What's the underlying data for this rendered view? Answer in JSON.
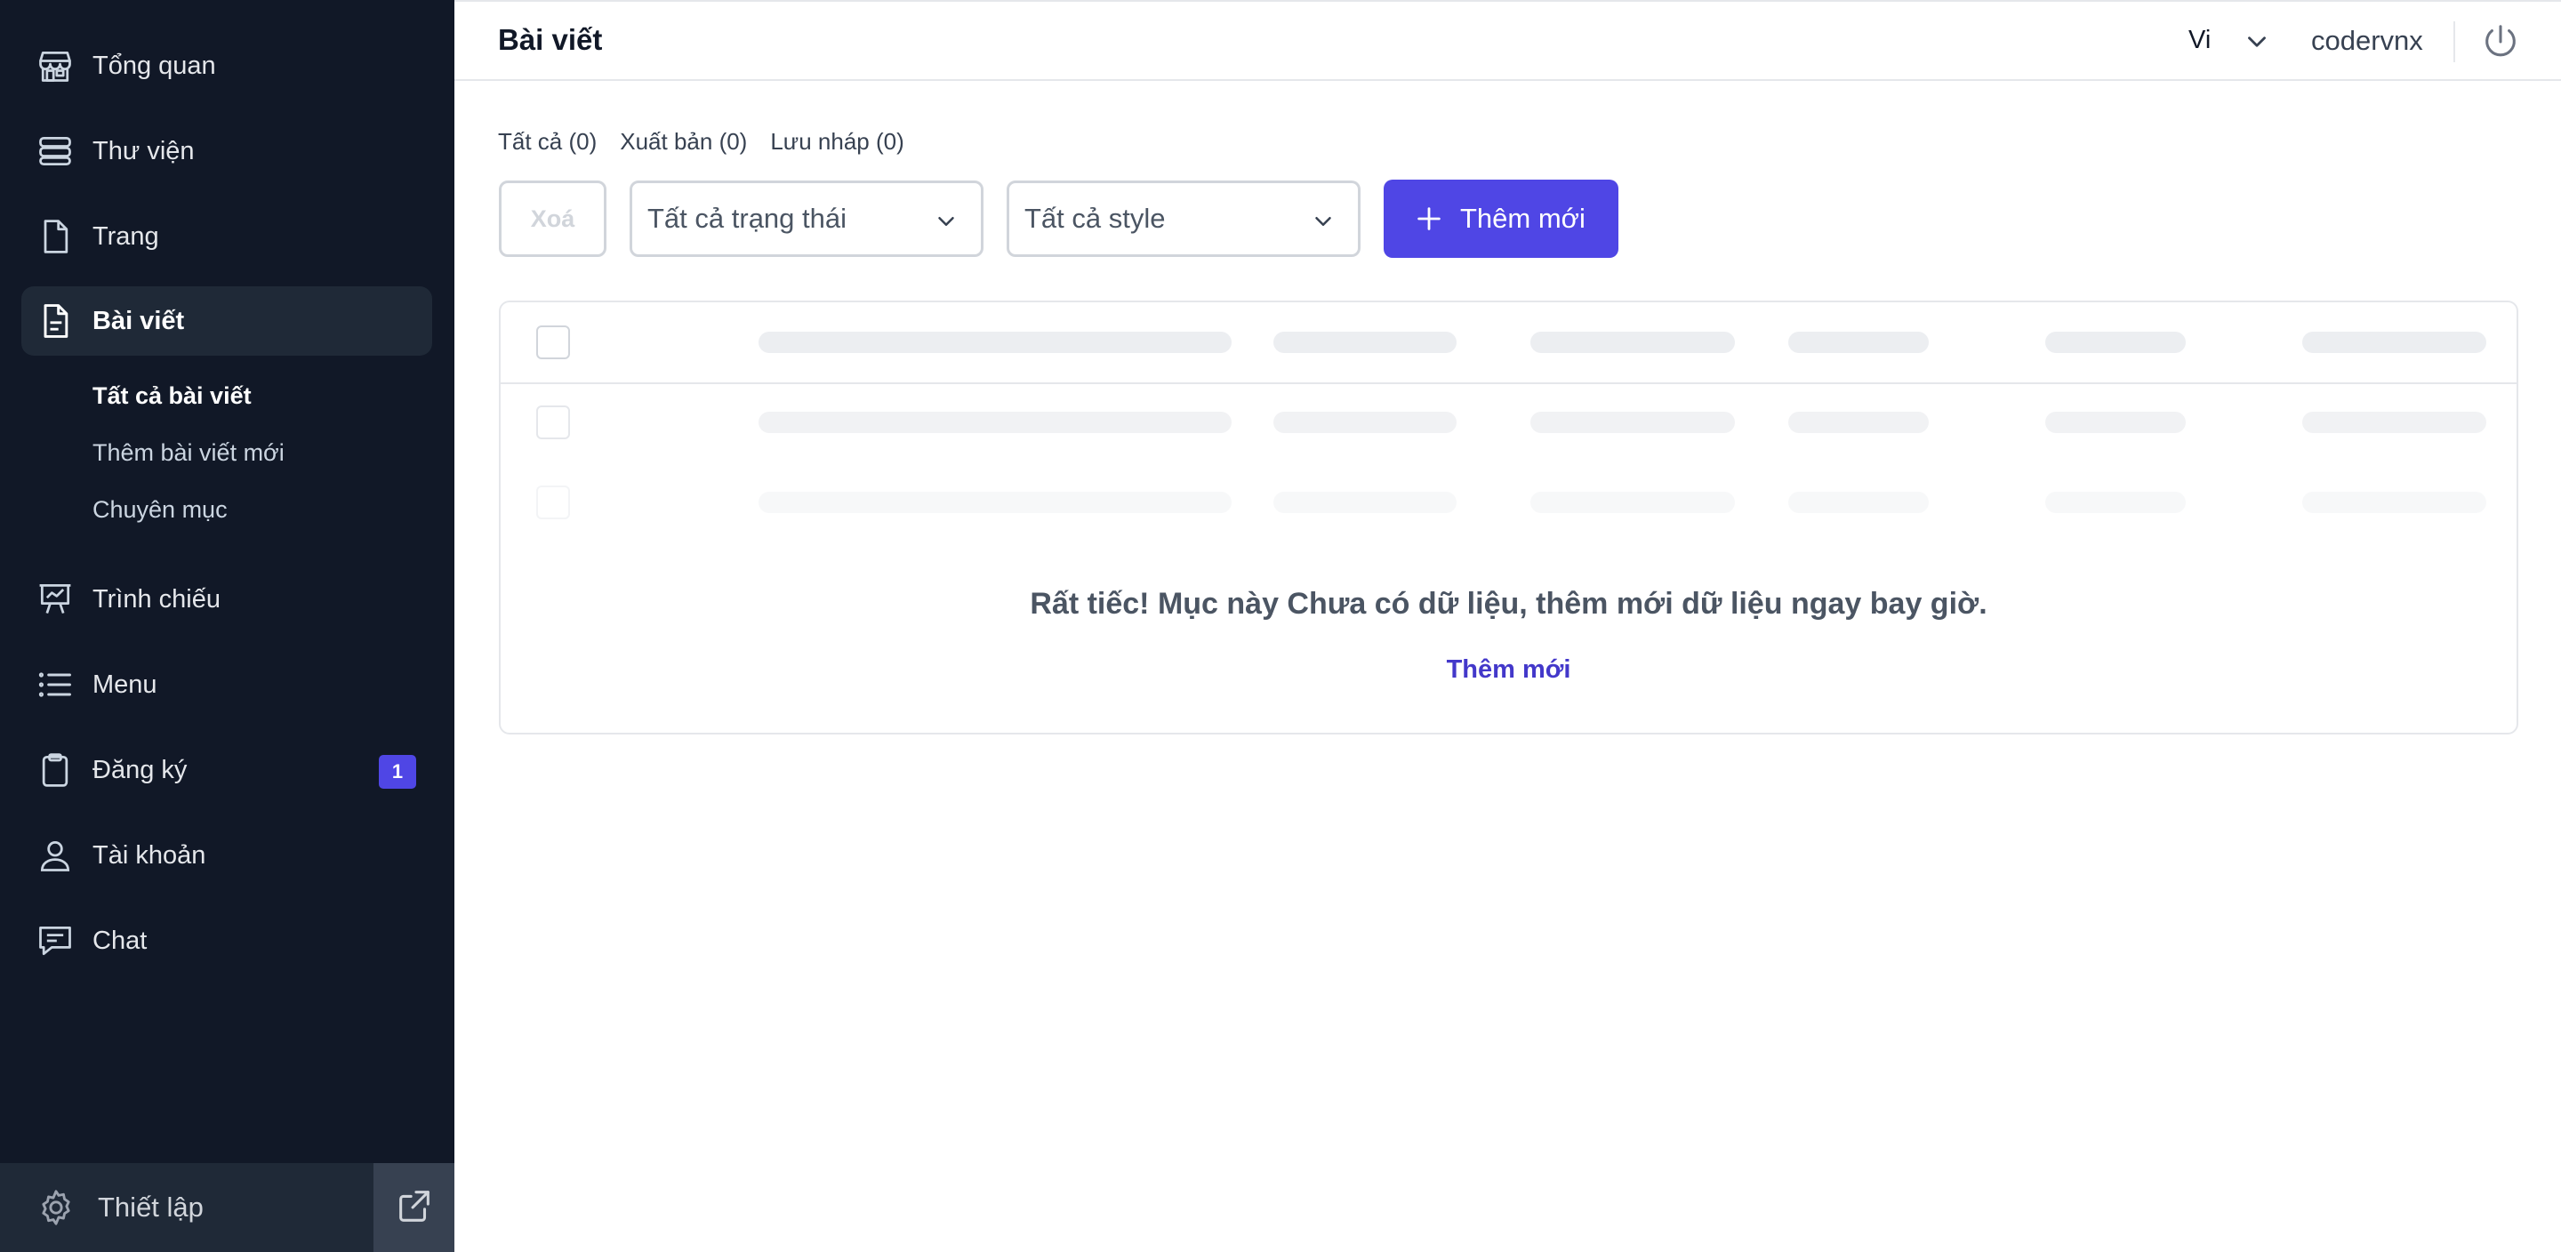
{
  "sidebar": {
    "items": [
      {
        "label": "Tổng quan",
        "icon": "store-icon"
      },
      {
        "label": "Thư viện",
        "icon": "database-icon"
      },
      {
        "label": "Trang",
        "icon": "page-icon"
      },
      {
        "label": "Bài viết",
        "icon": "document-text-icon",
        "active": true
      },
      {
        "label": "Trình chiếu",
        "icon": "presentation-chart-icon"
      },
      {
        "label": "Menu",
        "icon": "list-icon"
      },
      {
        "label": "Đăng ký",
        "icon": "clipboard-icon",
        "badge": "1"
      },
      {
        "label": "Tài khoản",
        "icon": "user-icon"
      },
      {
        "label": "Chat",
        "icon": "chat-icon"
      }
    ],
    "sub_items": [
      "Tất cả bài viết",
      "Thêm bài viết mới",
      "Chuyên mục"
    ],
    "settings_label": "Thiết lập"
  },
  "header": {
    "title": "Bài viết",
    "language": "Vi",
    "username": "codervnx"
  },
  "tabs": [
    "Tất cả (0)",
    "Xuất bản (0)",
    "Lưu nháp (0)"
  ],
  "toolbar": {
    "delete_label": "Xoá",
    "status_filter": "Tất cả trạng thái",
    "style_filter": "Tất cả style",
    "add_label": "Thêm mới"
  },
  "empty_state": {
    "message": "Rất tiếc! Mục này Chưa có dữ liệu, thêm mới dữ liệu ngay bay giờ.",
    "link": "Thêm mới"
  },
  "colors": {
    "sidebar_bg": "#111827",
    "accent": "#4f46e5",
    "link": "#4338ca"
  }
}
